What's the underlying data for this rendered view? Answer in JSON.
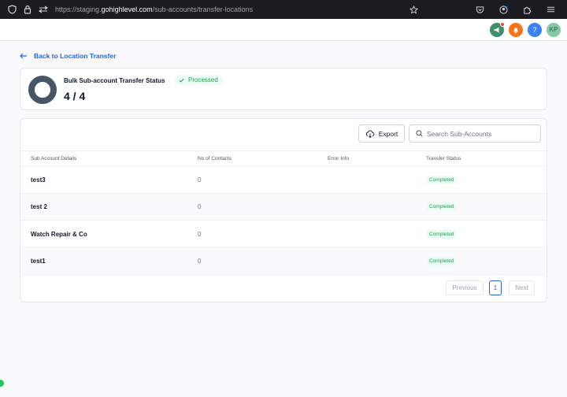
{
  "browser": {
    "url_prefix": "https://staging.",
    "url_host": "gohighlevel.com",
    "url_path": "/sub-accounts/transfer-locations"
  },
  "header": {
    "avatar_initials": "KP",
    "help_label": "?"
  },
  "back_link": "Back to Location Transfer",
  "status": {
    "title": "Bulk Sub-account Transfer Status",
    "badge": "Processed",
    "count": "4 / 4",
    "progress_fraction": 1.0
  },
  "toolbar": {
    "export_label": "Export",
    "search_placeholder": "Search Sub-Accounts"
  },
  "table": {
    "columns": [
      "Sub Account Details",
      "No of Contacts",
      "Error Info",
      "Transfer Status"
    ],
    "rows": [
      {
        "name": "test3",
        "contacts": "0",
        "error": "",
        "status": "Completed"
      },
      {
        "name": "test 2",
        "contacts": "0",
        "error": "",
        "status": "Completed"
      },
      {
        "name": "Watch Repair & Co",
        "contacts": "0",
        "error": "",
        "status": "Completed"
      },
      {
        "name": "test1",
        "contacts": "0",
        "error": "",
        "status": "Completed"
      }
    ]
  },
  "pagination": {
    "previous": "Previous",
    "page": "1",
    "next": "Next"
  },
  "colors": {
    "accent": "#2563eb",
    "success": "#16a34a",
    "donut": "#475569"
  }
}
